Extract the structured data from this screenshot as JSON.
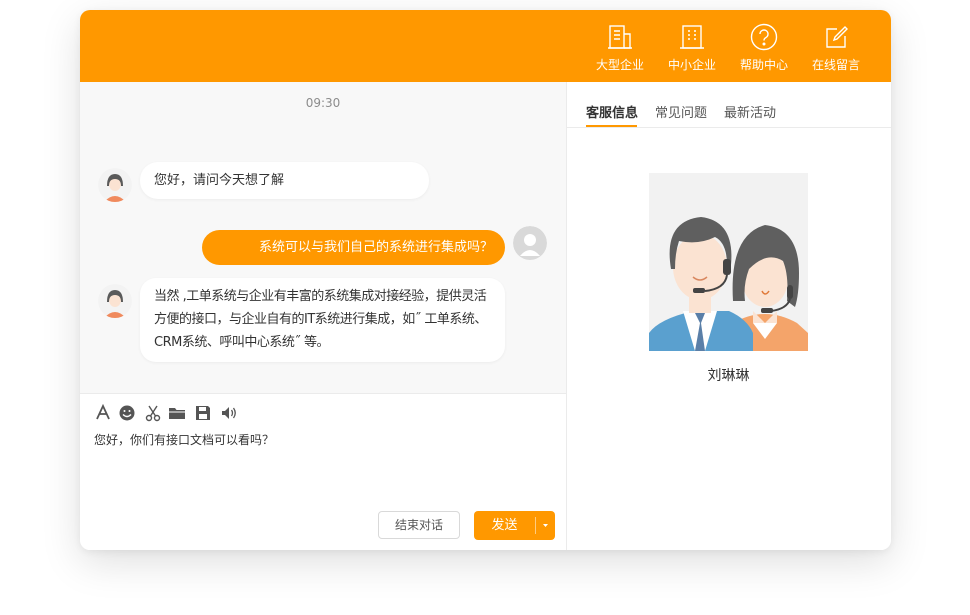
{
  "header": {
    "nav": [
      {
        "label": "大型企业",
        "icon": "large-enterprise-icon"
      },
      {
        "label": "中小企业",
        "icon": "small-enterprise-icon"
      },
      {
        "label": "帮助中心",
        "icon": "help-icon"
      },
      {
        "label": "在线留言",
        "icon": "edit-message-icon"
      }
    ]
  },
  "chat": {
    "time": "09:30",
    "messages": [
      {
        "from": "agent",
        "lines": [
          "您好，请问今天想了解"
        ]
      },
      {
        "from": "user",
        "lines": [
          "系统可以与我们自己的系统进行集成吗？"
        ]
      },
      {
        "from": "agent",
        "lines": [
          "当然 ,工单系统与企业有丰富的系统集成对接经验，提供灵活",
          "方便的接口，与企业自有的IT系统进行集成，如˝ 工单系统、",
          "CRM系统、呼叫中心系统˝ 等。"
        ]
      }
    ]
  },
  "composer": {
    "tools": [
      "font-icon",
      "emoji-icon",
      "scissors-icon",
      "folder-icon",
      "save-icon",
      "volume-icon"
    ],
    "text": "您好，你们有接口文档可以看吗？",
    "end_label": "结束对话",
    "send_label": "发送"
  },
  "sidebar": {
    "tabs": [
      {
        "label": "客服信息",
        "active": true
      },
      {
        "label": "常见问题",
        "active": false
      },
      {
        "label": "最新活动",
        "active": false
      }
    ],
    "agent_name": "刘琳琳"
  },
  "colors": {
    "accent": "#ff9800",
    "chat_bg": "#f8f8f8",
    "text": "#333333"
  }
}
